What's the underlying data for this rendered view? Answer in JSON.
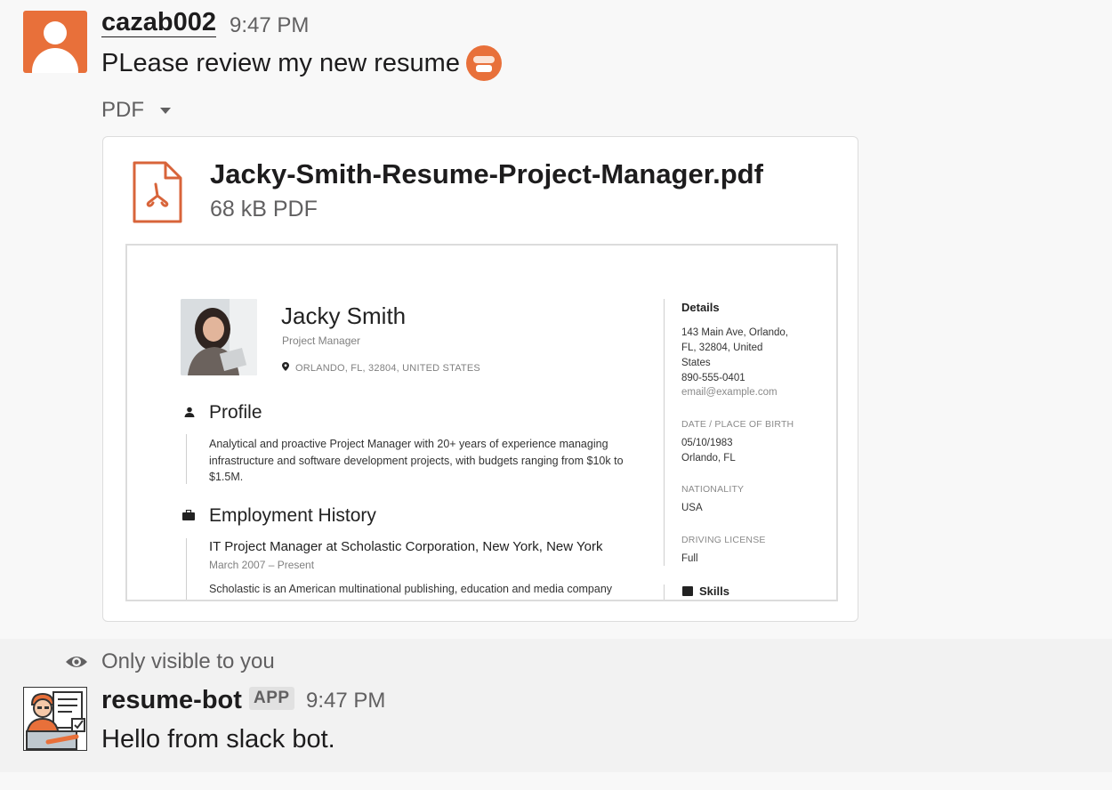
{
  "message1": {
    "username": "cazab002",
    "timestamp": "9:47 PM",
    "text": "PLease review my new resume",
    "emoji": "grimace-emoji",
    "attachment": {
      "toggle_label": "PDF",
      "file_name": "Jacky-Smith-Resume-Project-Manager.pdf",
      "file_meta": "68 kB PDF",
      "preview": {
        "name": "Jacky Smith",
        "job_title": "Project Manager",
        "location": "ORLANDO, FL, 32804, UNITED STATES",
        "profile_heading": "Profile",
        "profile_lines": [
          "Analytical and proactive Project Manager with 20+ years of experience managing",
          "infrastructure and software development projects, with budgets ranging from $10k to",
          "$1.5M."
        ],
        "employment_heading": "Employment History",
        "job1_title": "IT Project Manager at Scholastic Corporation, New York, New York",
        "job1_dates": "March 2007  –  Present",
        "job1_desc": "Scholastic is an American multinational publishing, education and media company",
        "details_heading": "Details",
        "address_lines": [
          "143 Main Ave, Orlando,",
          "FL, 32804, United",
          "States"
        ],
        "phone": "890-555-0401",
        "email": "email@example.com",
        "birth_label": "DATE / PLACE OF BIRTH",
        "birth_date": "05/10/1983",
        "birth_place": "Orlando, FL",
        "nationality_label": "NATIONALITY",
        "nationality": "USA",
        "license_label": "DRIVING LICENSE",
        "license": "Full",
        "skills_heading": "Skills"
      }
    }
  },
  "message2": {
    "visibility_note": "Only visible to you",
    "username": "resume-bot",
    "badge": "APP",
    "timestamp": "9:47 PM",
    "text": "Hello from slack bot."
  },
  "colors": {
    "avatar_orange": "#e8703a",
    "pdf_icon": "#d8643a",
    "text_primary": "#1d1c1d",
    "text_secondary": "#616061"
  }
}
